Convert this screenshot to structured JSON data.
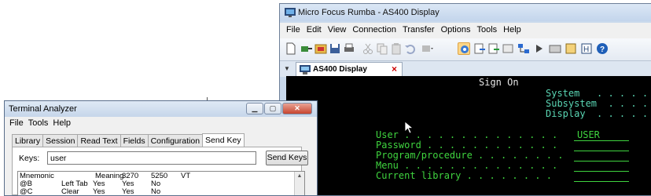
{
  "rumba": {
    "title": "Micro Focus Rumba - AS400 Display",
    "menu": [
      "File",
      "Edit",
      "View",
      "Connection",
      "Transfer",
      "Options",
      "Tools",
      "Help"
    ],
    "tab": {
      "label": "AS400 Display",
      "close": "×"
    },
    "terminal": {
      "heading": "Sign On",
      "system_labels": [
        "System   . . . . .",
        "Subsystem  . . . .",
        "Display  . . . . ."
      ],
      "fields": [
        {
          "label": "User . . . . . . . . . . . . . .",
          "value": "USER"
        },
        {
          "label": "Password . . . . . . . . . . . .",
          "value": ""
        },
        {
          "label": "Program/procedure . . . . . . . .",
          "value": ""
        },
        {
          "label": "Menu . . . . . . . . . . . . . .",
          "value": ""
        },
        {
          "label": "Current library . . . . . . . .",
          "value": ""
        }
      ]
    }
  },
  "analyzer": {
    "title": "Terminal Analyzer",
    "menu": [
      "File",
      "Tools",
      "Help"
    ],
    "tabs": [
      "Library",
      "Session",
      "Read Text",
      "Fields",
      "Configuration",
      "Send Key"
    ],
    "active_tab": "Send Key",
    "keys_label": "Keys:",
    "keys_value": "user",
    "send_button": "Send Keys",
    "list_headers": [
      "Mnemonic",
      "Meaning",
      "3270",
      "5250",
      "VT"
    ],
    "list_rows": [
      [
        "@B",
        "Left Tab",
        "Yes",
        "Yes",
        "No"
      ],
      [
        "@C",
        "Clear",
        "Yes",
        "Yes",
        "No"
      ]
    ]
  }
}
